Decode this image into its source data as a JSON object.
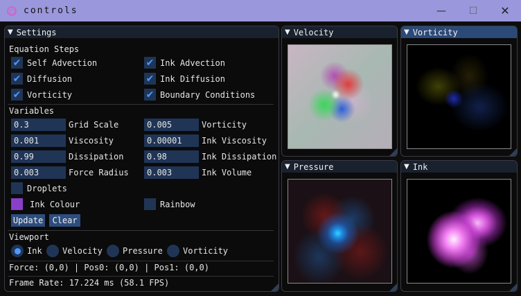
{
  "window": {
    "title": "controls",
    "minimize_glyph": "—",
    "maximize_glyph": "☐",
    "close_glyph": "✕"
  },
  "settings": {
    "title": "Settings",
    "equation_steps_label": "Equation Steps",
    "steps": [
      {
        "label": "Self Advection",
        "checked": true
      },
      {
        "label": "Ink Advection",
        "checked": true
      },
      {
        "label": "Diffusion",
        "checked": true
      },
      {
        "label": "Ink Diffusion",
        "checked": true
      },
      {
        "label": "Vorticity",
        "checked": true
      },
      {
        "label": "Boundary Conditions",
        "checked": true
      }
    ],
    "check_glyph": "✔",
    "variables_label": "Variables",
    "variables": [
      {
        "value": "0.3",
        "label": "Grid Scale"
      },
      {
        "value": "0.005",
        "label": "Vorticity"
      },
      {
        "value": "0.001",
        "label": "Viscosity"
      },
      {
        "value": "0.00001",
        "label": "Ink Viscosity"
      },
      {
        "value": "0.99",
        "label": "Dissipation"
      },
      {
        "value": "0.98",
        "label": "Ink Dissipation"
      },
      {
        "value": "0.003",
        "label": "Force Radius"
      },
      {
        "value": "0.003",
        "label": "Ink Volume"
      }
    ],
    "droplets_label": "Droplets",
    "droplets_checked": false,
    "ink_colour_label": "Ink Colour",
    "ink_colour": "#8a3fc8",
    "rainbow_label": "Rainbow",
    "rainbow_checked": false,
    "update_label": "Update",
    "clear_label": "Clear",
    "viewport_label": "Viewport",
    "viewport_options": [
      "Ink",
      "Velocity",
      "Pressure",
      "Vorticity"
    ],
    "viewport_selected": "Ink",
    "force_status": "Force: (0,0) | Pos0: (0,0) | Pos1: (0,0)",
    "frame_rate": "Frame Rate: 17.224 ms (58.1 FPS)"
  },
  "views": {
    "velocity_title": "Velocity",
    "vorticity_title": "Vorticity",
    "pressure_title": "Pressure",
    "ink_title": "Ink",
    "collapse_glyph": "▼"
  },
  "colors": {
    "accent": "#4a9aff",
    "frame_bg": "#203556",
    "titlebar": "#9b97dc",
    "active_header": "#2c4a78"
  }
}
